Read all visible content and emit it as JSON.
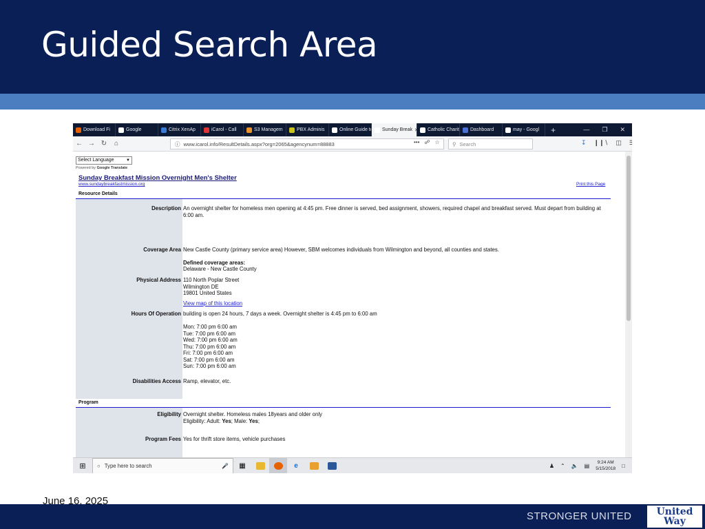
{
  "slide": {
    "title": "Guided Search Area",
    "date": "June 16, 2025",
    "footer_text": "STRONGER UNITED",
    "logo_line1": "United",
    "logo_line2": "Way"
  },
  "browser": {
    "tabs": [
      {
        "label": "Download Fi",
        "icon_color": "#e66000"
      },
      {
        "label": "Google",
        "icon_color": "#ffffff"
      },
      {
        "label": "Citrix XenAp",
        "icon_color": "#3a7bd5"
      },
      {
        "label": "iCarol - Call",
        "icon_color": "#d33"
      },
      {
        "label": "S3 Managem",
        "icon_color": "#e8912d"
      },
      {
        "label": "PBX Adminis",
        "icon_color": "#c9c21a"
      },
      {
        "label": "Online Guide to I",
        "icon_color": "#ffffff"
      },
      {
        "label": "Sunday Break",
        "icon_color": "#ffffff",
        "active": true
      },
      {
        "label": "Catholic Chariti",
        "icon_color": "#ffffff"
      },
      {
        "label": "Dashboard",
        "icon_color": "#4a6fd5"
      },
      {
        "label": "may - Googl",
        "icon_color": "#ffffff"
      }
    ],
    "new_tab": "+",
    "url": "www.icarol.info/ResultDetails.aspx?org=2065&agencynum=88883",
    "search_placeholder": "Search",
    "url_menu": "•••"
  },
  "page": {
    "language_select": "Select Language",
    "powered_by": "Powered by",
    "google_translate": "Google Translate",
    "org_name": "Sunday Breakfast Mission Overnight Men's Shelter",
    "org_url": "www.sundaybreakfastmission.org",
    "print_link": "Print this Page",
    "section_resource": "Resource Details",
    "section_program": "Program",
    "fields": {
      "description_label": "Description",
      "description": "An overnight shelter for homeless men opening at 4:45 pm. Free dinner is served, bed assignment, showers, required chapel and breakfast served. Must depart from building at 6:00 am.",
      "coverage_label": "Coverage Area",
      "coverage": "New Castle County (primary service area) However, SBM welcomes individuals from Wilmington and beyond, all counties and states.",
      "defined_coverage_head": "Defined coverage areas:",
      "defined_coverage": "Delaware - New Castle County",
      "address_label": "Physical Address",
      "address_line1": "110 North Poplar Street",
      "address_line2": "Wilmington DE",
      "address_line3": "19801 United States",
      "map_link": "View map of this location",
      "hours_label": "Hours Of Operation",
      "hours": "building is open 24 hours, 7 days a week. Overnight shelter is 4:45 pm to 6:00 am",
      "hours_mon": "Mon: 7:00 pm 6:00 am",
      "hours_tue": "Tue: 7:00 pm 6:00 am",
      "hours_wed": "Wed: 7:00 pm 6:00 am",
      "hours_thu": "Thu: 7:00 pm 6:00 am",
      "hours_fri": "Fri: 7:00 pm 6:00 am",
      "hours_sat": "Sat: 7:00 pm 6:00 am",
      "hours_sun": "Sun: 7:00 pm 6:00 am",
      "disabilities_label": "Disabilities Access",
      "disabilities": "Ramp, elevator, etc.",
      "eligibility_label": "Eligibility",
      "eligibility": "Overnight shelter. Homeless males 18years and older only",
      "eligibility_detail_prefix": "Eligibility: Adult:",
      "eligibility_adult": "Yes",
      "eligibility_male_prefix": "; Male:",
      "eligibility_male": "Yes",
      "eligibility_end": ";",
      "fees_label": "Program Fees",
      "fees": "Yes for thrift store items, vehicle purchases"
    }
  },
  "taskbar": {
    "search_placeholder": "Type here to search",
    "time": "9:24 AM",
    "date": "5/15/2018"
  }
}
